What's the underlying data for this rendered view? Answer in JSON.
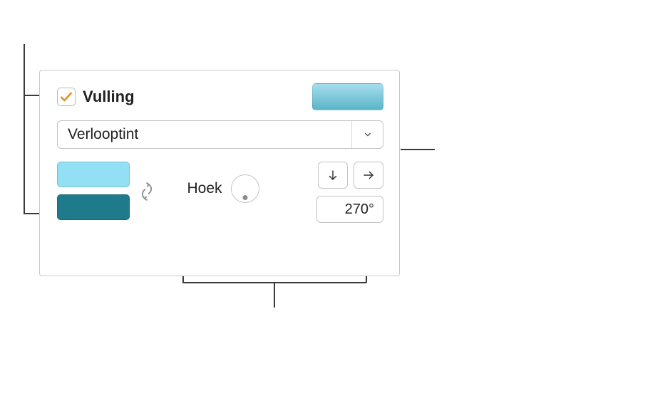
{
  "fill": {
    "checkbox_label": "Vulling",
    "checked": true,
    "type_select": "Verlooptint",
    "preview_gradient": {
      "from": "#A5DEEE",
      "to": "#5AB5C7"
    },
    "stops": {
      "start": "#93E0F5",
      "end": "#1F7A8C"
    },
    "angle": {
      "label": "Hoek",
      "value_display": "270°",
      "value": 270
    }
  },
  "icons": {
    "checkmark": "checkmark-icon",
    "chevron_down": "chevron-down-icon",
    "swap": "swap-vertical-icon",
    "arrow_down": "arrow-down-icon",
    "arrow_right": "arrow-right-icon"
  }
}
